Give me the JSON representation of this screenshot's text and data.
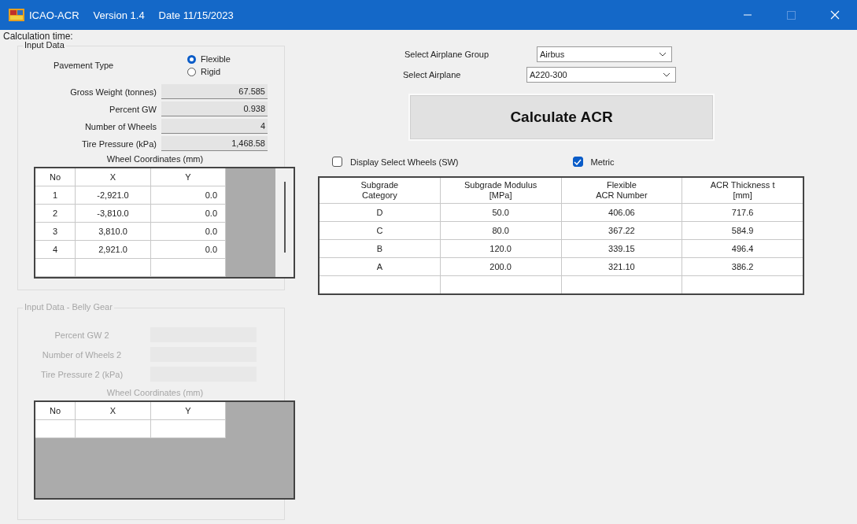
{
  "window": {
    "app_name": "ICAO-ACR",
    "version": "Version 1.4",
    "date": "Date 11/15/2023"
  },
  "calculation_time_label": "Calculation time:",
  "input_data": {
    "title": "Input Data",
    "pavement_type": {
      "label": "Pavement Type",
      "options": [
        {
          "label": "Flexible",
          "selected": true
        },
        {
          "label": "Rigid",
          "selected": false
        }
      ]
    },
    "fields": [
      {
        "label": "Gross Weight (tonnes)",
        "value": "67.585"
      },
      {
        "label": "Percent GW",
        "value": "0.938"
      },
      {
        "label": "Number of Wheels",
        "value": "4"
      },
      {
        "label": "Tire Pressure (kPa)",
        "value": "1,468.58"
      }
    ],
    "wheel_coordinates": {
      "title": "Wheel Coordinates (mm)",
      "columns": [
        "No",
        "X",
        "Y"
      ],
      "rows": [
        [
          "1",
          "-2,921.0",
          "0.0"
        ],
        [
          "2",
          "-3,810.0",
          "0.0"
        ],
        [
          "3",
          "3,810.0",
          "0.0"
        ],
        [
          "4",
          "2,921.0",
          "0.0"
        ]
      ]
    }
  },
  "belly_gear": {
    "title": "Input Data - Belly Gear",
    "disabled": true,
    "fields": [
      {
        "label": "Percent GW 2"
      },
      {
        "label": "Number of Wheels 2"
      },
      {
        "label": "Tire Pressure 2 (kPa)"
      }
    ],
    "wheel_coordinates": {
      "title": "Wheel Coordinates (mm)",
      "columns": [
        "No",
        "X",
        "Y"
      ]
    }
  },
  "airplane_group": {
    "label": "Select Airplane Group",
    "value": "Airbus"
  },
  "airplane": {
    "label": "Select Airplane",
    "value": "A220-300"
  },
  "calculate_button": "Calculate ACR",
  "display_select_wheels": {
    "label": "Display Select Wheels (SW)",
    "checked": false
  },
  "metric": {
    "label": "Metric",
    "checked": true
  },
  "results_table": {
    "columns": [
      "Subgrade\nCategory",
      "Subgrade Modulus\n[MPa]",
      "Flexible\nACR Number",
      "ACR Thickness t\n[mm]"
    ],
    "rows": [
      [
        "D",
        "50.0",
        "406.06",
        "717.6"
      ],
      [
        "C",
        "80.0",
        "367.22",
        "584.9"
      ],
      [
        "B",
        "120.0",
        "339.15",
        "496.4"
      ],
      [
        "A",
        "200.0",
        "321.10",
        "386.2"
      ]
    ]
  }
}
